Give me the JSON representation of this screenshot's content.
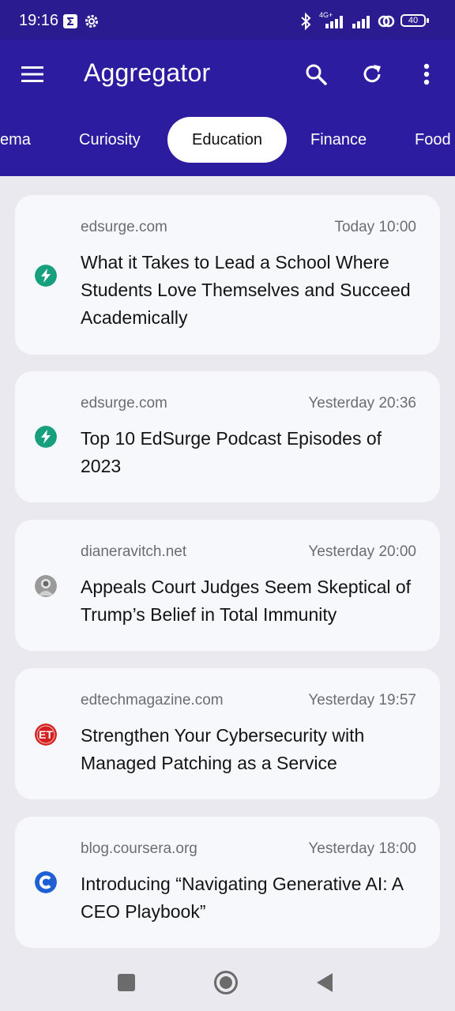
{
  "status": {
    "time": "19:16",
    "network": "4G+",
    "battery": "40"
  },
  "app": {
    "title": "Aggregator"
  },
  "tabs": [
    "ema",
    "Curiosity",
    "Education",
    "Finance",
    "Food"
  ],
  "active_tab": "Education",
  "articles": [
    {
      "source": "edsurge.com",
      "time": "Today 10:00",
      "title": "What it Takes to Lead a School Where Students Love Themselves and Succeed Academically",
      "icon": "edsurge-icon"
    },
    {
      "source": "edsurge.com",
      "time": "Yesterday 20:36",
      "title": "Top 10 EdSurge Podcast Episodes of 2023",
      "icon": "edsurge-icon"
    },
    {
      "source": "dianeravitch.net",
      "time": "Yesterday 20:00",
      "title": "Appeals Court Judges Seem Skeptical of Trump’s Belief in Total Immunity",
      "icon": "avatar-icon"
    },
    {
      "source": "edtechmagazine.com",
      "time": "Yesterday 19:57",
      "title": "Strengthen Your Cybersecurity with Managed Patching as a Service",
      "icon": "edtech-icon"
    },
    {
      "source": "blog.coursera.org",
      "time": "Yesterday 18:00",
      "title": "Introducing “Navigating Generative AI: A CEO Playbook”",
      "icon": "coursera-icon"
    }
  ],
  "colors": {
    "app_bar": "#2c1ca0",
    "status_bar": "#2a1b90",
    "background": "#e9e9ef",
    "card": "#f7f8fb",
    "edsurge_green": "#18a07e",
    "edtech_red": "#d42020",
    "coursera_blue": "#1f5fd4"
  }
}
